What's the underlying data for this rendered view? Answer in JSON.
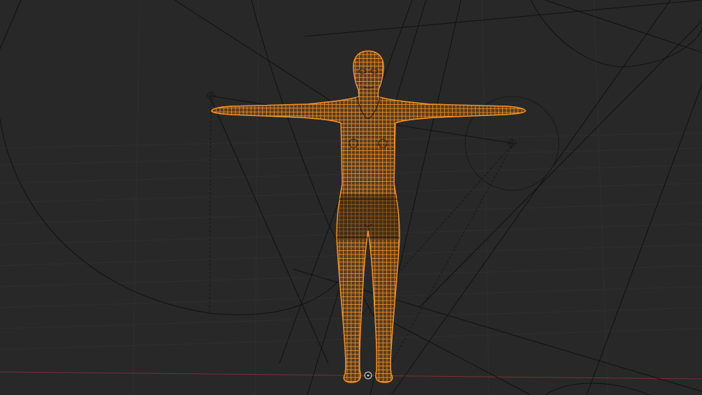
{
  "viewport": {
    "background": "#282828",
    "mode": "wireframe",
    "selected_object": "human-mesh",
    "selection_color": "#f2922a",
    "x_axis_color": "#7a3138"
  },
  "objects": [
    {
      "name": "human-mesh",
      "kind": "mesh",
      "selected": true
    },
    {
      "name": "light-empty-left",
      "kind": "empty",
      "selected": false
    },
    {
      "name": "light-empty-right",
      "kind": "empty",
      "selected": false
    },
    {
      "name": "world-origin",
      "kind": "origin",
      "selected": false
    }
  ]
}
